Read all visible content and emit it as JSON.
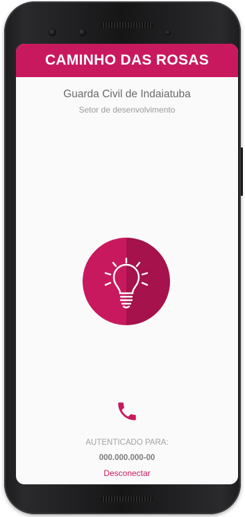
{
  "app": {
    "title": "CAMINHO DAS ROSAS",
    "accent_color": "#c9195e",
    "accent_dark": "#a5124c"
  },
  "header": {
    "organization": "Guarda Civil de Indaiatuba",
    "sector": "Setor de desenvolvimento"
  },
  "main": {
    "alert_button_icon": "lightbulb-icon",
    "call_button_icon": "phone-icon"
  },
  "footer": {
    "auth_label": "AUTENTICADO PARA:",
    "auth_value": "000.000.000-00",
    "disconnect_label": "Desconectar"
  }
}
